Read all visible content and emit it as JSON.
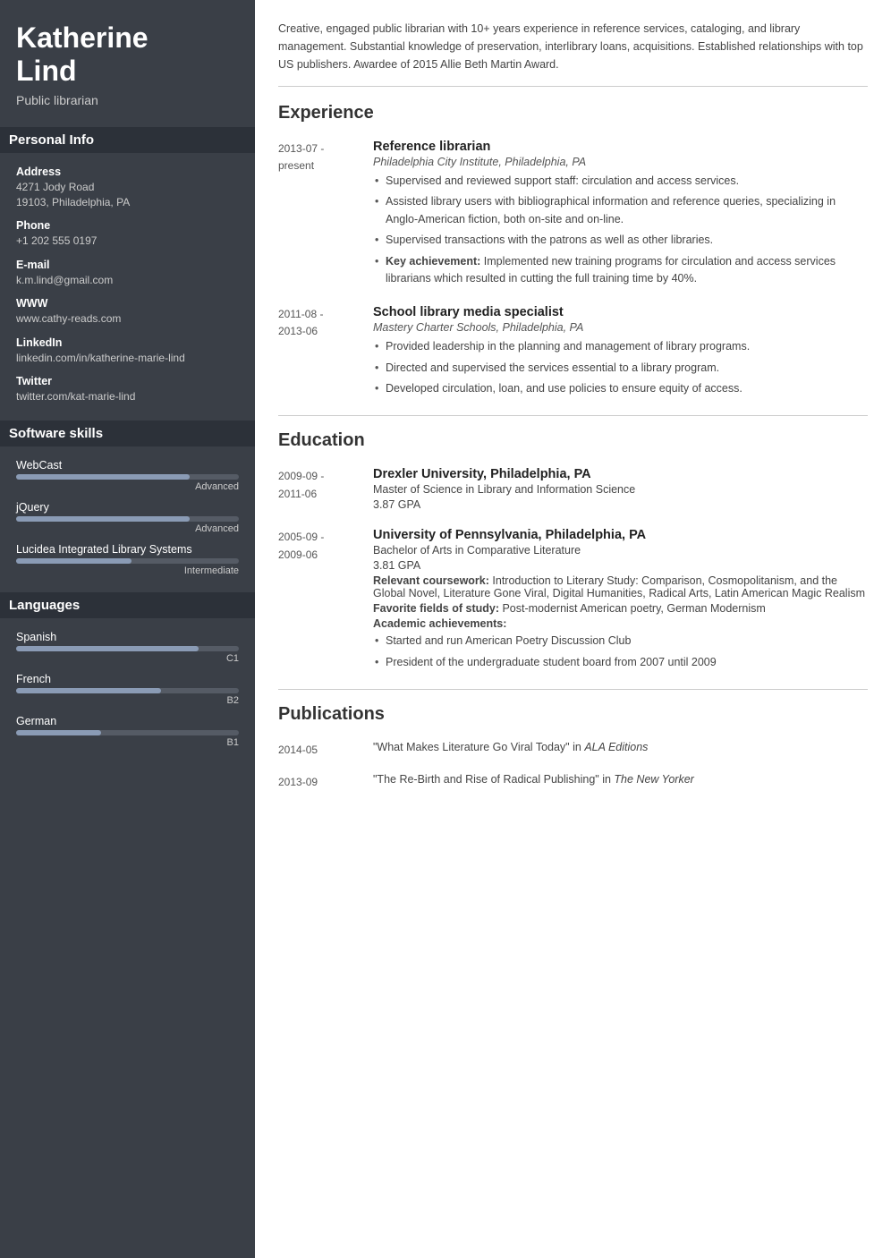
{
  "sidebar": {
    "name": "Katherine\nLind",
    "title": "Public librarian",
    "personal_info_header": "Personal Info",
    "fields": [
      {
        "label": "Address",
        "value": "4271 Jody Road\n19103, Philadelphia, PA"
      },
      {
        "label": "Phone",
        "value": "+1 202 555 0197"
      },
      {
        "label": "E-mail",
        "value": "k.m.lind@gmail.com"
      },
      {
        "label": "WWW",
        "value": "www.cathy-reads.com"
      },
      {
        "label": "LinkedIn",
        "value": "linkedin.com/in/katherine-marie-lind"
      },
      {
        "label": "Twitter",
        "value": "twitter.com/kat-marie-lind"
      }
    ],
    "software_skills_header": "Software skills",
    "skills": [
      {
        "name": "WebCast",
        "level": "Advanced",
        "pct": 78
      },
      {
        "name": "jQuery",
        "level": "Advanced",
        "pct": 78
      },
      {
        "name": "Lucidea Integrated Library Systems",
        "level": "Intermediate",
        "pct": 52
      }
    ],
    "languages_header": "Languages",
    "languages": [
      {
        "name": "Spanish",
        "level": "C1",
        "pct": 82
      },
      {
        "name": "French",
        "level": "B2",
        "pct": 65
      },
      {
        "name": "German",
        "level": "B1",
        "pct": 38
      }
    ]
  },
  "main": {
    "summary": "Creative, engaged public librarian with 10+ years experience in reference services, cataloging, and library management. Substantial knowledge of preservation, interlibrary loans, acquisitions. Established relationships with top US publishers. Awardee of 2015 Allie Beth Martin Award.",
    "experience_header": "Experience",
    "experience": [
      {
        "date": "2013-07 -\npresent",
        "title": "Reference librarian",
        "subtitle": "Philadelphia City Institute, Philadelphia, PA",
        "bullets": [
          "Supervised and reviewed support staff: circulation and access services.",
          "Assisted library users with bibliographical information and reference queries, specializing in Anglo-American fiction, both on-site and on-line.",
          "Supervised transactions with the patrons as well as other libraries.",
          "Key achievement: Implemented new training programs for circulation and access services librarians which resulted in cutting the full training time by 40%."
        ],
        "bullet_bold": [
          3
        ]
      },
      {
        "date": "2011-08 -\n2013-06",
        "title": "School library media specialist",
        "subtitle": "Mastery Charter Schools, Philadelphia, PA",
        "bullets": [
          "Provided leadership in the planning and management of library programs.",
          "Directed and supervised the services essential to a library program.",
          "Developed circulation, loan, and use policies to ensure equity of access."
        ]
      }
    ],
    "education_header": "Education",
    "education": [
      {
        "date": "2009-09 -\n2011-06",
        "title": "Drexler University, Philadelphia, PA",
        "degree": "Master of Science in Library and Information Science",
        "gpa": "3.87 GPA"
      },
      {
        "date": "2005-09 -\n2009-06",
        "title": "University of Pennsylvania, Philadelphia, PA",
        "degree": "Bachelor of Arts in Comparative Literature",
        "gpa": "3.81 GPA",
        "coursework_label": "Relevant coursework:",
        "coursework": "Introduction to Literary Study: Comparison, Cosmopolitanism, and the Global Novel, Literature Gone Viral, Digital Humanities, Radical Arts, Latin American Magic Realism",
        "fields_label": "Favorite fields of study:",
        "fields": "Post-modernist American poetry, German Modernism",
        "achievements_label": "Academic achievements:",
        "achievements": [
          "Started and run American Poetry Discussion Club",
          "President of the undergraduate student board from 2007 until 2009"
        ]
      }
    ],
    "publications_header": "Publications",
    "publications": [
      {
        "date": "2014-05",
        "text_before": "\"What Makes Literature Go Viral Today\" in ",
        "publication": "ALA Editions",
        "text_after": ""
      },
      {
        "date": "2013-09",
        "text_before": "\"The Re-Birth and Rise of Radical Publishing\" in ",
        "publication": "The New Yorker",
        "text_after": ""
      }
    ]
  }
}
